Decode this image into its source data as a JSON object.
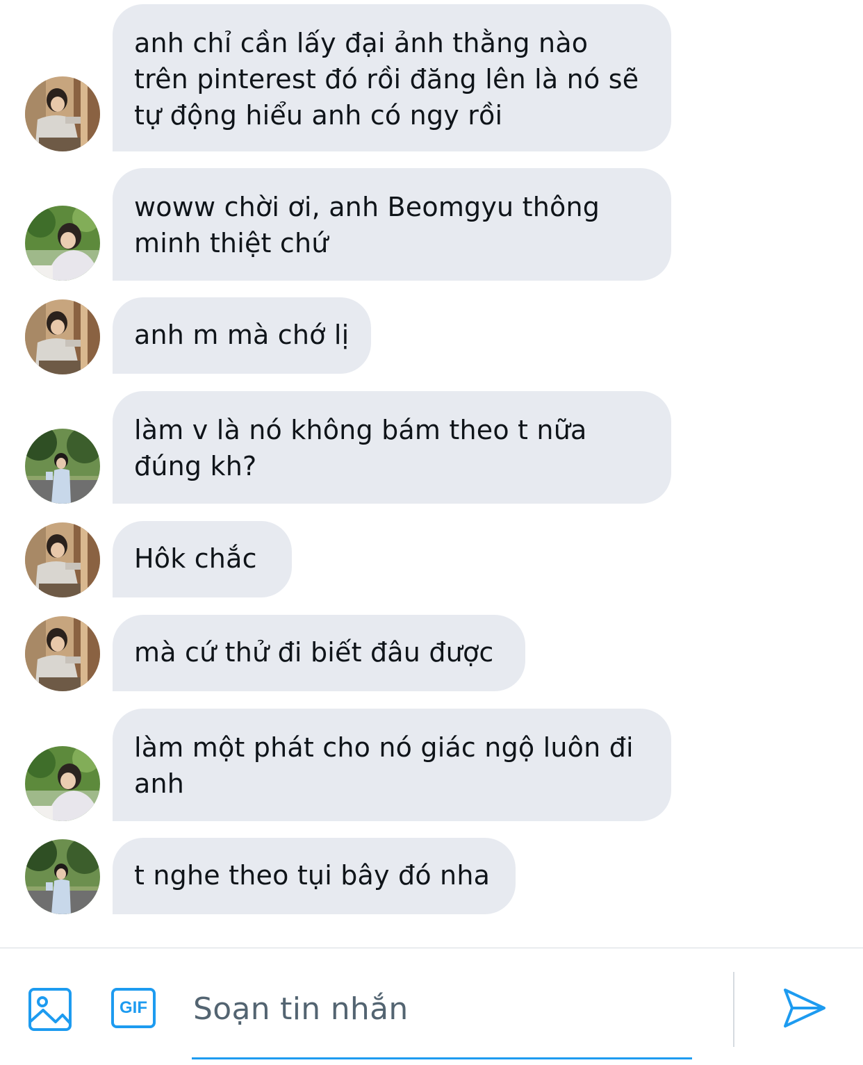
{
  "messages": [
    {
      "text": "anh chỉ cần lấy đại ảnh thằng nào\ntrên pinterest đó rồi đăng lên là nó sẽ\ntự động hiểu anh có ngy rồi",
      "avatar": "A"
    },
    {
      "text": "woww chời ơi, anh Beomgyu thông\nminh thiệt chứ",
      "avatar": "B"
    },
    {
      "text": "anh m mà chớ lị",
      "avatar": "A"
    },
    {
      "text": "làm v là nó không bám theo t nữa\nđúng kh?",
      "avatar": "C"
    },
    {
      "text": "Hôk chắc",
      "avatar": "A"
    },
    {
      "text": "mà cứ thử đi biết đâu được",
      "avatar": "A"
    },
    {
      "text": "làm một phát cho nó giác ngộ luôn đi\nanh",
      "avatar": "B"
    },
    {
      "text": "t nghe theo tụi bây đó nha",
      "avatar": "C"
    }
  ],
  "composer": {
    "placeholder": "Soạn tin nhắn",
    "gif_label": "GIF",
    "image_icon": "image-icon",
    "send_icon": "send-icon"
  },
  "colors": {
    "accent": "#1d9bf0",
    "bubble": "#e7eaf0",
    "text": "#0f1419",
    "placeholder": "#536471"
  }
}
